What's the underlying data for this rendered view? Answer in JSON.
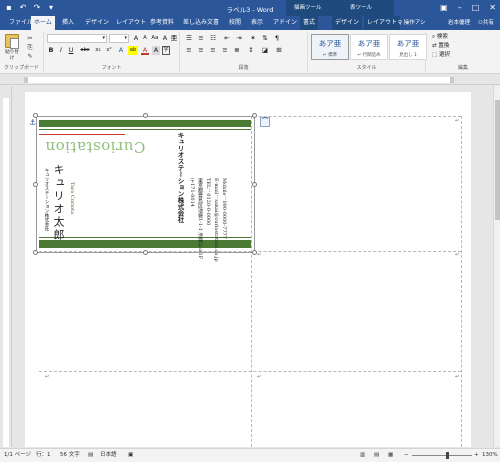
{
  "titlebar": {
    "title": "ラベル3 - Word",
    "ctx_drawing": "描画ツール",
    "ctx_table": "表ツール",
    "qat": {
      "save_icon": "save-icon",
      "undo_icon": "undo-icon",
      "redo_icon": "redo-icon",
      "customize_icon": "chevron-down-icon"
    },
    "controls": {
      "options_icon": "ribbon-display-icon",
      "minimize": "–",
      "maximize": "□",
      "close": "✕"
    }
  },
  "tabs": {
    "file": "ファイル",
    "home": "ホーム",
    "insert": "挿入",
    "design": "デザイン",
    "layout": "レイアウト",
    "references": "参考資料",
    "mailings": "差し込み文書",
    "review": "校閲",
    "view": "表示",
    "addins": "アドイン",
    "format": "書式",
    "table_design": "デザイン",
    "table_layout": "レイアウト",
    "help": "操作アシ",
    "user": "岩本優理",
    "share": "共有"
  },
  "ribbon": {
    "clipboard": {
      "paste": "貼り付け",
      "label": "クリップボード"
    },
    "font": {
      "font_name": "",
      "font_size": "",
      "label": "フォント",
      "bold": "B",
      "italic": "I",
      "underline": "U",
      "strike": "abc",
      "subscript": "x₂",
      "superscript": "x²",
      "grow": "A",
      "shrink": "A",
      "case": "Aa",
      "clear": "A",
      "ruby": "亜",
      "border": "A",
      "effects": "A",
      "highlight": "ab",
      "color": "A",
      "shading": "A",
      "enclose": "字"
    },
    "paragraph": {
      "label": "段落"
    },
    "styles": {
      "label": "スタイル",
      "items": [
        {
          "sample": "あア亜",
          "name": "↵ 標準"
        },
        {
          "sample": "あア亜",
          "name": "↵ 行間詰め"
        },
        {
          "sample": "あア亜",
          "name": "見出し 1"
        }
      ]
    },
    "editing": {
      "find": "検索",
      "replace": "置換",
      "select": "選択",
      "label": "編集"
    }
  },
  "card": {
    "brand": "Curiostation",
    "company_small": "キュリオステーション株式会社",
    "name": "キュリオ太郎",
    "title_en": "Taro Curiota",
    "company_main": "キュリオステーション株式会社",
    "address_lines": [
      "〒171-0014",
      "東京都豊島区池袋1-1-1 池袋ビル1F",
      "TEL：0120-0-0000",
      "E-mail：sakai@curiostation.co.jp",
      "Mobile：090-0000-7777"
    ]
  },
  "colors": {
    "card_green": "#4a7a33",
    "brand_green": "#8fbf7a",
    "red_rule": "#c0392b",
    "word_blue": "#2b579a"
  },
  "status": {
    "page": "1/1 ページ",
    "line": "行：1",
    "chars": "56 文字",
    "lang": "日本語",
    "zoom": "130%",
    "views": {
      "read": "read-mode-icon",
      "print": "print-layout-icon",
      "web": "web-layout-icon"
    }
  }
}
